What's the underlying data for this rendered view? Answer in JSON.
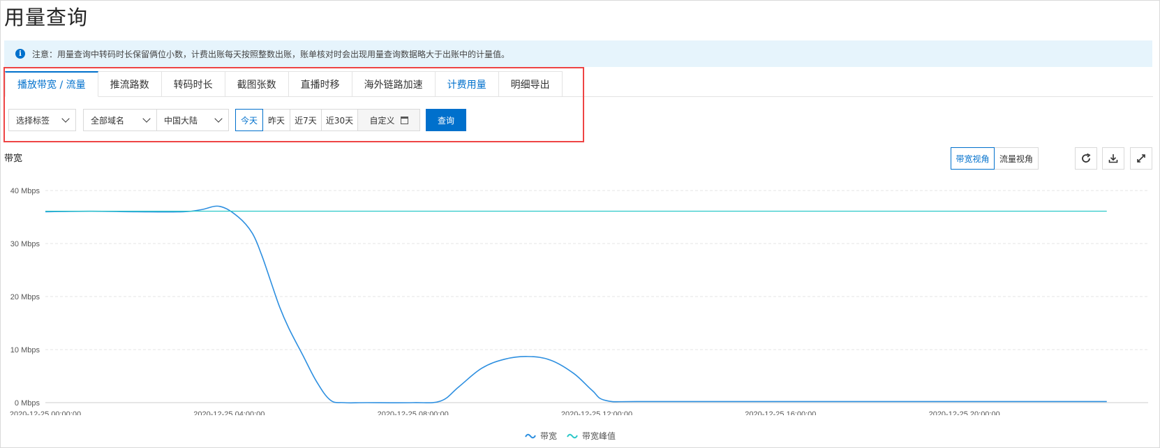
{
  "page": {
    "title": "用量查询"
  },
  "notice": {
    "icon": "info-icon",
    "text": "注意：用量查询中转码时长保留俩位小数，计费出账每天按照整数出账，账单核对时会出现用量查询数据略大于出账中的计量值。"
  },
  "tabs": [
    {
      "label": "播放带宽 / 流量",
      "active": true
    },
    {
      "label": "推流路数"
    },
    {
      "label": "转码时长"
    },
    {
      "label": "截图张数"
    },
    {
      "label": "直播时移"
    },
    {
      "label": "海外链路加速"
    },
    {
      "label": "计费用量"
    },
    {
      "label": "明细导出"
    }
  ],
  "filters": {
    "tags": "选择标签",
    "domain": "全部域名",
    "region": "中国大陆",
    "dates": [
      "今天",
      "昨天",
      "近7天",
      "近30天"
    ],
    "custom": "自定义",
    "query": "查询"
  },
  "chart_header": {
    "label": "带宽",
    "views": [
      "带宽视角",
      "流量视角"
    ],
    "actions": [
      "refresh-icon",
      "download-icon",
      "fullscreen-icon"
    ]
  },
  "colors": {
    "accent": "#0070cc",
    "series_bandwidth": "#2d8fe0",
    "series_peak": "#2cc8c8",
    "notice_bg": "#e6f4fc",
    "highlight": "#ee4444"
  },
  "chart_data": {
    "type": "line",
    "ylabel": "",
    "xlabel": "",
    "ylim": [
      0,
      40
    ],
    "yticks": [
      "0 Mbps",
      "10 Mbps",
      "20 Mbps",
      "30 Mbps",
      "40 Mbps"
    ],
    "xticks": [
      "2020-12-25 00:00:00",
      "2020-12-25 04:00:00",
      "2020-12-25 08:00:00",
      "2020-12-25 12:00:00",
      "2020-12-25 16:00:00",
      "2020-12-25 20:00:00"
    ],
    "x_hours_range": [
      0,
      23.1
    ],
    "grid": true,
    "legend": "bottom-center",
    "series": [
      {
        "name": "带宽",
        "x": [
          0,
          1,
          2,
          3,
          3.4,
          3.8,
          4.2,
          4.5,
          4.7,
          4.9,
          5.1,
          5.3,
          5.6,
          5.9,
          6.2,
          6.5,
          7,
          8,
          8.6,
          9,
          9.5,
          10,
          10.5,
          11,
          11.5,
          11.9,
          12.2,
          13,
          16,
          20,
          23.1
        ],
        "y": [
          36,
          36.1,
          36,
          36,
          36.4,
          37,
          35,
          32,
          28,
          23,
          18,
          14,
          9,
          4,
          0.5,
          0,
          0,
          0,
          0.3,
          3,
          6.5,
          8.2,
          8.7,
          8,
          5.5,
          2.3,
          0.4,
          0.2,
          0.2,
          0.2,
          0.2
        ]
      },
      {
        "name": "带宽峰值",
        "x": [
          0,
          23.1
        ],
        "y": [
          36.1,
          36.1
        ]
      }
    ]
  }
}
